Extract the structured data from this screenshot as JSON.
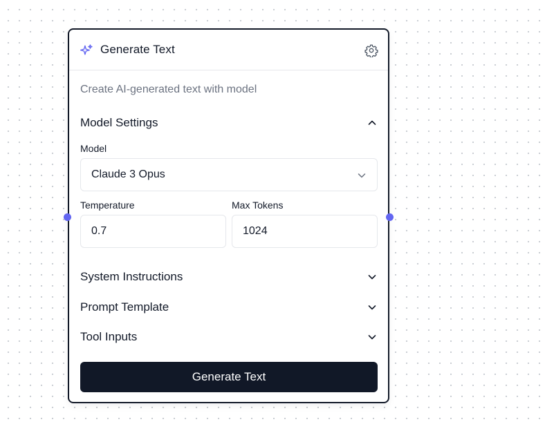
{
  "node": {
    "title": "Generate Text",
    "description": "Create AI-generated text with model",
    "icons": {
      "header": "sparkles-icon",
      "settings": "gear-icon"
    },
    "accent_color": "#6366f1",
    "border_color": "#111827"
  },
  "model_settings": {
    "title": "Model Settings",
    "expanded": true,
    "model_label": "Model",
    "model_value": "Claude 3 Opus",
    "temperature_label": "Temperature",
    "temperature_value": "0.7",
    "max_tokens_label": "Max Tokens",
    "max_tokens_value": "1024"
  },
  "sections": [
    {
      "title": "System Instructions",
      "expanded": false
    },
    {
      "title": "Prompt Template",
      "expanded": false
    },
    {
      "title": "Tool Inputs",
      "expanded": false
    }
  ],
  "action": {
    "label": "Generate Text",
    "color": "#111827"
  }
}
